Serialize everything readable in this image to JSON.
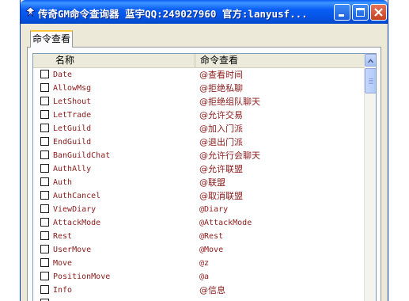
{
  "window": {
    "title": "传奇GM命令查询器 蓝宇QQ:249027960 官方:lanyusf...",
    "controls": [
      "minimize",
      "maximize",
      "close"
    ]
  },
  "tabs": [
    {
      "label": "命令查看",
      "active": true
    }
  ],
  "list": {
    "headers": {
      "name": "名称",
      "view": "命令查看"
    },
    "rows": [
      {
        "name": "Date",
        "desc": "@查看时间"
      },
      {
        "name": "AllowMsg",
        "desc": "@拒绝私聊"
      },
      {
        "name": "LetShout",
        "desc": "@拒绝组队聊天"
      },
      {
        "name": "LetTrade",
        "desc": "@允许交易"
      },
      {
        "name": "LetGuild",
        "desc": "@加入门派"
      },
      {
        "name": "EndGuild",
        "desc": "@退出门派"
      },
      {
        "name": "BanGuildChat",
        "desc": "@允许行会聊天"
      },
      {
        "name": "AuthAlly",
        "desc": "@允许联盟"
      },
      {
        "name": "Auth",
        "desc": "@联盟"
      },
      {
        "name": "AuthCancel",
        "desc": "@取消联盟"
      },
      {
        "name": "ViewDiary",
        "desc": "@Diary"
      },
      {
        "name": "AttackMode",
        "desc": "@AttackMode"
      },
      {
        "name": "Rest",
        "desc": "@Rest"
      },
      {
        "name": "UserMove",
        "desc": "@Move"
      },
      {
        "name": "Move",
        "desc": "@z"
      },
      {
        "name": "PositionMove",
        "desc": "@a"
      },
      {
        "name": "Info",
        "desc": "@信息"
      },
      {
        "name": "",
        "desc": ""
      }
    ]
  },
  "colors": {
    "titlebar": "#0a5ef5",
    "row_text": "#8b1a1a",
    "tab_highlight": "#ffc83c"
  }
}
